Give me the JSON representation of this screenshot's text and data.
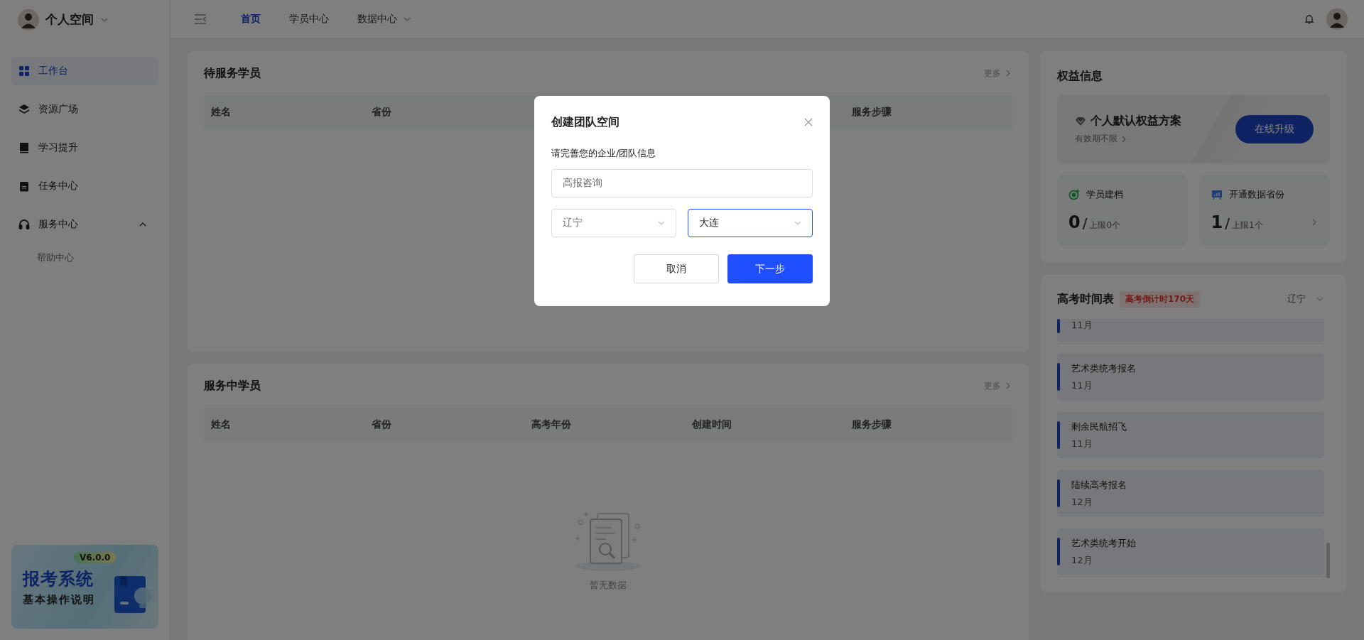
{
  "sidebar": {
    "workspace": "个人空间",
    "items": [
      {
        "label": "工作台",
        "selected": true
      },
      {
        "label": "资源广场",
        "selected": false
      },
      {
        "label": "学习提升",
        "selected": false
      },
      {
        "label": "任务中心",
        "selected": false
      },
      {
        "label": "服务中心",
        "selected": false,
        "expanded": true,
        "children": [
          {
            "label": "帮助中心",
            "selected": false
          }
        ]
      }
    ],
    "banner": {
      "version": "V6.0.0",
      "title": "报考系统",
      "subtitle": "基本操作说明"
    }
  },
  "topbar": {
    "tabs": [
      {
        "label": "首页",
        "selected": true,
        "dropdown": false
      },
      {
        "label": "学员中心",
        "selected": false,
        "dropdown": false
      },
      {
        "label": "数据中心",
        "selected": false,
        "dropdown": true
      }
    ]
  },
  "pending": {
    "title": "待服务学员",
    "more": "更多",
    "columns": [
      "姓名",
      "省份",
      "服务步骤"
    ]
  },
  "serving": {
    "title": "服务中学员",
    "more": "更多",
    "columns": [
      "姓名",
      "省份",
      "高考年份",
      "创建时间",
      "服务步骤"
    ],
    "empty": "暂无数据"
  },
  "benefits": {
    "title": "权益信息",
    "plan": "个人默认权益方案",
    "validity": "有效期不限",
    "upgrade": "在线升级",
    "stats": [
      {
        "kind": "archive",
        "label": "学员建档",
        "count": "0",
        "sep": "/",
        "limit": "上限0个",
        "link": false
      },
      {
        "kind": "province",
        "label": "开通数据省份",
        "count": "1",
        "sep": "/",
        "limit": "上限1个",
        "link": true
      }
    ]
  },
  "timetable": {
    "title": "高考时间表",
    "countdown": "高考倒计时170天",
    "province": "辽宁",
    "events": [
      {
        "month": "11月"
      },
      {
        "title": "艺术类统考报名",
        "month": "11月"
      },
      {
        "title": "剩余民航招飞",
        "month": "11月"
      },
      {
        "title": "陆续高考报名",
        "month": "12月"
      },
      {
        "title": "艺术类统考开始",
        "month": "12月"
      }
    ]
  },
  "dialog": {
    "title": "创建团队空间",
    "prompt": "请完善您的企业/团队信息",
    "name": "高报咨询",
    "selects": [
      {
        "value": "辽宁",
        "focused": false
      },
      {
        "value": "大连",
        "focused": true
      }
    ],
    "buttons": [
      {
        "label": "取消",
        "kind": "secondary"
      },
      {
        "label": "下一步",
        "kind": "primary"
      }
    ]
  }
}
